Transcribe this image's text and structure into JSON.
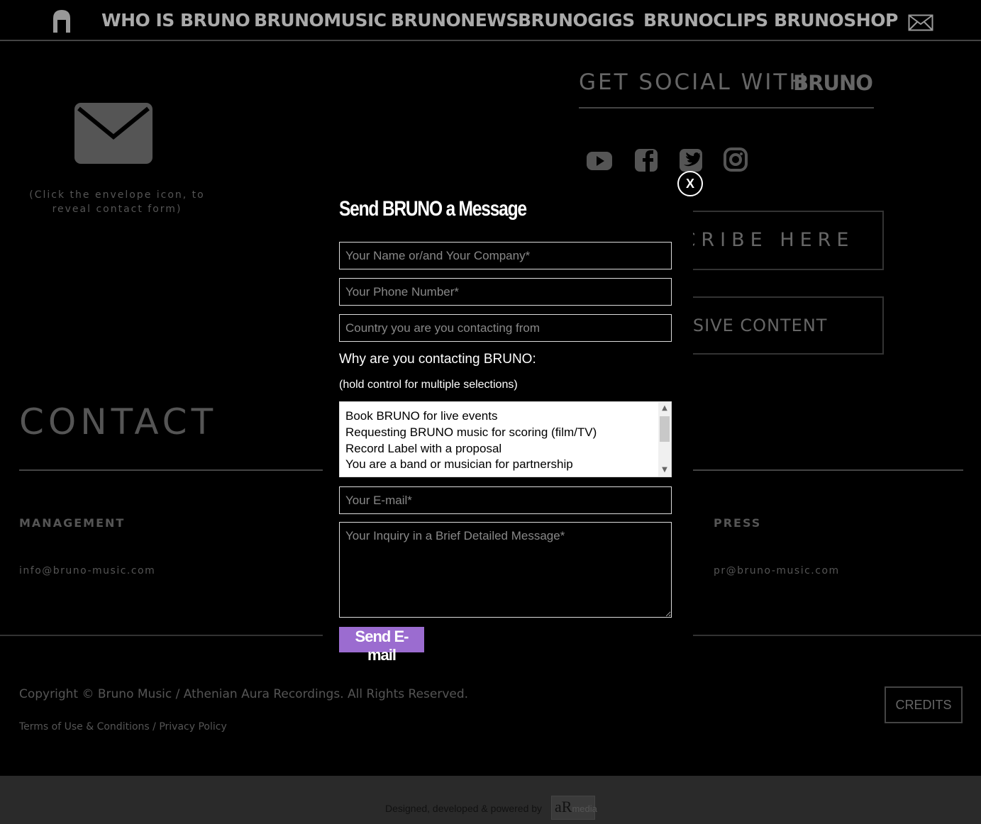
{
  "nav": {
    "items": [
      "WHO IS BRUNO",
      "BRUNOMUSIC",
      "BRUNONEWS",
      "BRUNOGIGS",
      "BRUNOCLIPS",
      "BRUNOSHOP"
    ]
  },
  "contact_hint": "(Click the envelope icon, to reveal contact form)",
  "social": {
    "title": "GET SOCIAL WITH",
    "brand": "BRUNO",
    "icons": [
      "youtube-icon",
      "facebook-icon",
      "twitter-icon",
      "instagram-icon"
    ]
  },
  "subscribe_label": "SUBSCRIBE HERE",
  "exclusive_label": "EXCLUSIVE CONTENT",
  "contact_heading": "CONTACT",
  "columns": {
    "management": {
      "label": "MANAGEMENT",
      "email": "info@bruno-music.com"
    },
    "press": {
      "label": "PRESS",
      "email": "pr@bruno-music.com"
    }
  },
  "footer": {
    "copyright": "Copyright © Bruno Music / Athenian Aura Recordings. All Rights Reserved.",
    "terms": "Terms of Use & Conditions",
    "separator": " / ",
    "privacy": "Privacy Policy",
    "credits": "CREDITS",
    "powered": "Designed, developed & powered by",
    "powered_logo": "aR",
    "powered_logo_small": "media"
  },
  "modal": {
    "close": "X",
    "title": "Send BRUNO a Message",
    "name_placeholder": "Your Name or/and Your Company*",
    "phone_placeholder": "Your Phone Number*",
    "country_placeholder": "Country you are you contacting from",
    "why_label": "Why are you contacting BRUNO:",
    "hold_label": "(hold control for multiple selections)",
    "options": [
      "Book BRUNO for live events",
      "Requesting BRUNO music for scoring (film/TV)",
      "Record Label with a proposal",
      "You are a band or musician for partnership"
    ],
    "email_placeholder": "Your E-mail*",
    "message_placeholder": "Your Inquiry in a Brief Detailed Message*",
    "send": "Send E-mail"
  }
}
